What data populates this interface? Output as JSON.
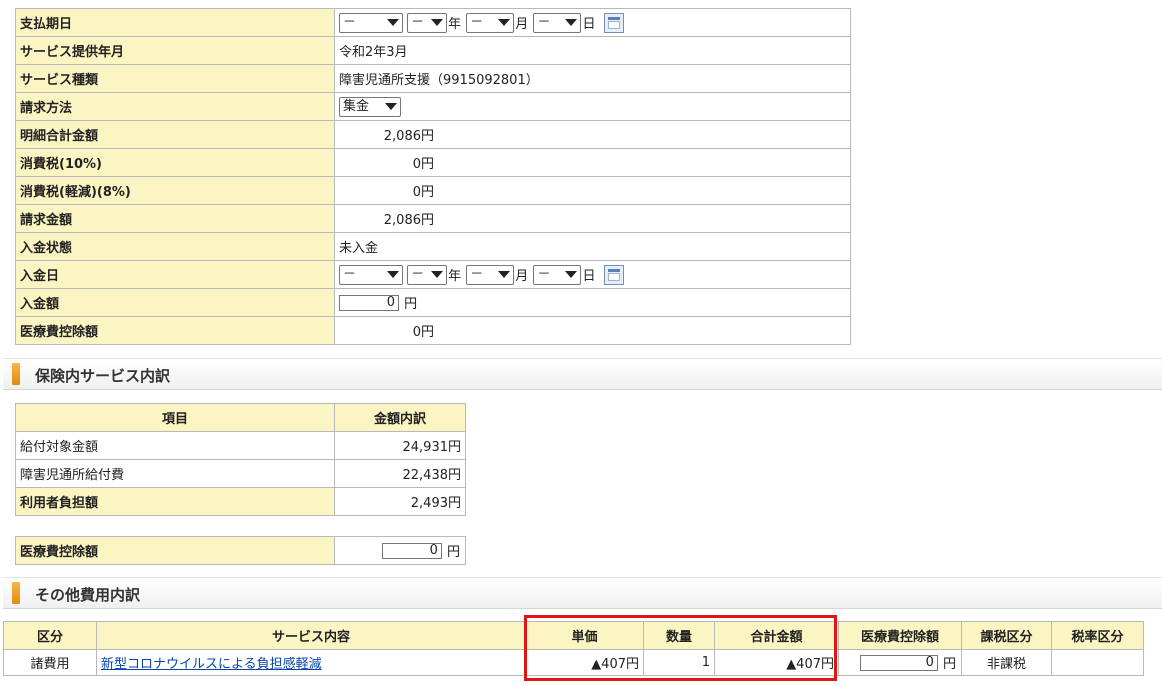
{
  "detail": {
    "payment_due": {
      "label": "支払期日",
      "year": "－",
      "month": "－",
      "day": "－",
      "year_unit": "年",
      "month_unit": "月",
      "day_unit": "日"
    },
    "service_month": {
      "label": "サービス提供年月",
      "value": "令和2年3月"
    },
    "service_type": {
      "label": "サービス種類",
      "value": "障害児通所支援（9915092801）"
    },
    "billing_method": {
      "label": "請求方法",
      "value": "集金"
    },
    "detail_total": {
      "label": "明細合計金額",
      "value": "2,086円"
    },
    "tax10": {
      "label": "消費税(10%)",
      "value": "0円"
    },
    "tax8": {
      "label": "消費税(軽減)(8%)",
      "value": "0円"
    },
    "billed": {
      "label": "請求金額",
      "value": "2,086円"
    },
    "payment_status": {
      "label": "入金状態",
      "value": "未入金"
    },
    "payment_date": {
      "label": "入金日",
      "year": "－",
      "month": "－",
      "day": "－",
      "year_unit": "年",
      "month_unit": "月",
      "day_unit": "日"
    },
    "payment_amount": {
      "label": "入金額",
      "value": "0",
      "unit": "円"
    },
    "medical_deduction": {
      "label": "医療費控除額",
      "value": "0円"
    }
  },
  "insurance_section": {
    "title": "保険内サービス内訳",
    "headers": [
      "項目",
      "金額内訳"
    ],
    "rows": [
      {
        "item": "給付対象金額",
        "amount": "24,931円"
      },
      {
        "item": "障害児通所給付費",
        "amount": "22,438円"
      },
      {
        "item": "利用者負担額",
        "amount": "2,493円"
      }
    ],
    "deduction": {
      "label": "医療費控除額",
      "value": "0",
      "unit": "円"
    }
  },
  "other_section": {
    "title": "その他費用内訳",
    "headers": [
      "区分",
      "サービス内容",
      "単価",
      "数量",
      "合計金額",
      "医療費控除額",
      "課税区分",
      "税率区分"
    ],
    "row": {
      "category": "諸費用",
      "service": "新型コロナウイルスによる負担感軽減",
      "unit_price": "▲407円",
      "qty": "1",
      "total": "▲407円",
      "deduction": "0",
      "deduction_unit": "円",
      "tax_type": "非課税",
      "tax_rate": ""
    }
  },
  "colors": {
    "label_bg": "#fbf5c3",
    "highlight": "#e01616",
    "section_bar": "#e48a10",
    "link": "#0645ad"
  }
}
